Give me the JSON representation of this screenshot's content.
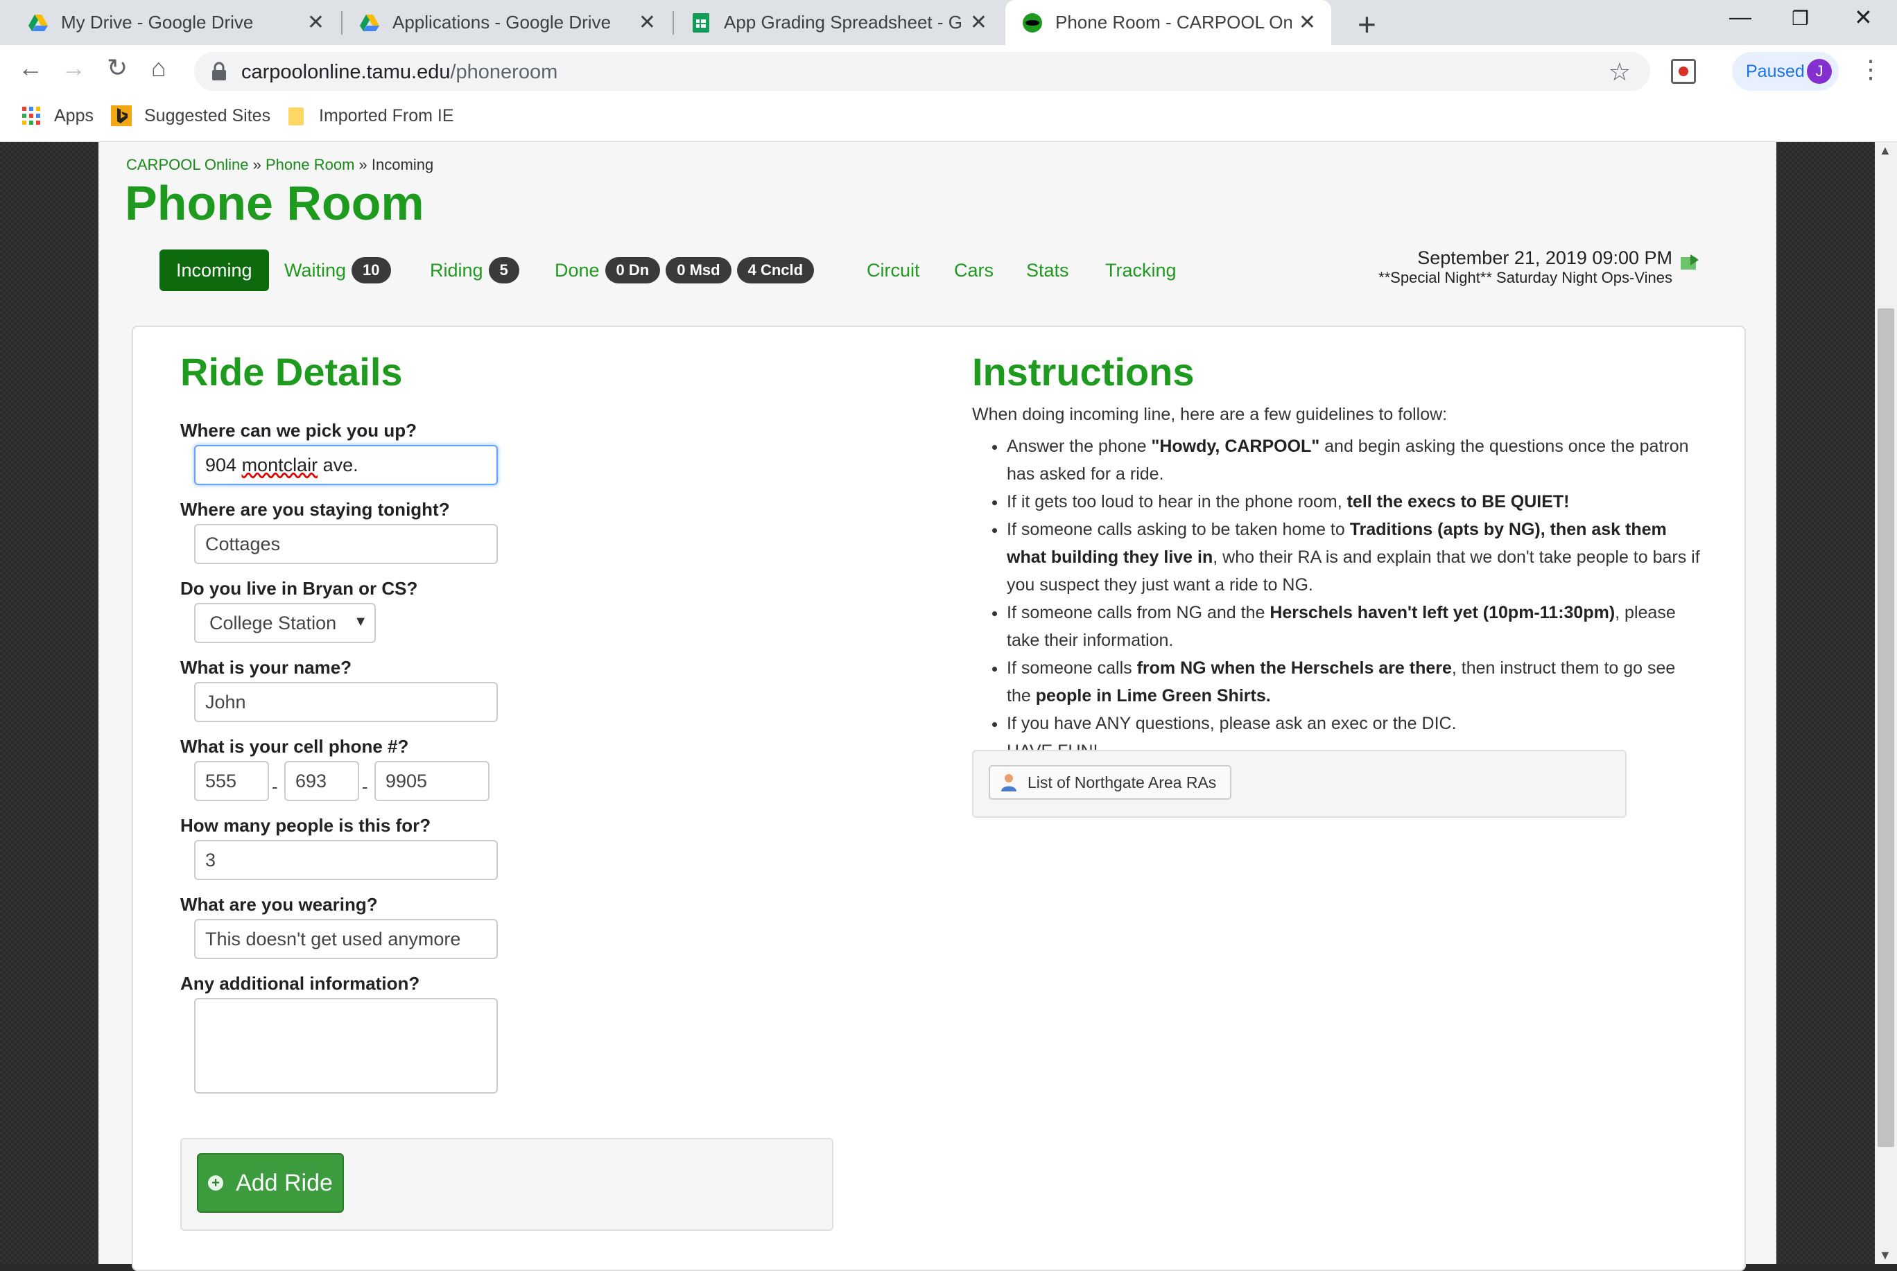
{
  "browser": {
    "tabs": [
      {
        "title": "My Drive - Google Drive",
        "icon": "google-drive-icon"
      },
      {
        "title": "Applications - Google Drive",
        "icon": "google-drive-icon"
      },
      {
        "title": "App Grading Spreadsheet - Goog",
        "icon": "google-sheets-icon"
      },
      {
        "title": "Phone Room - CARPOOL Online",
        "icon": "carpool-icon",
        "active": true
      }
    ],
    "url_host": "carpoolonline.tamu.edu",
    "url_path": "/phoneroom",
    "profile_status": "Paused",
    "profile_initial": "J",
    "bookmarks": [
      {
        "label": "Apps",
        "icon": "apps-grid-icon"
      },
      {
        "label": "Suggested Sites",
        "icon": "bing-icon"
      },
      {
        "label": "Imported From IE",
        "icon": "folder-icon"
      }
    ]
  },
  "breadcrumb": {
    "root": "CARPOOL Online",
    "sep1": "»",
    "section": "Phone Room",
    "sep2": "»",
    "current": "Incoming"
  },
  "page_title": "Phone Room",
  "nav": {
    "incoming": "Incoming",
    "waiting": {
      "label": "Waiting",
      "count": "10"
    },
    "riding": {
      "label": "Riding",
      "count": "5"
    },
    "done": {
      "label": "Done",
      "badges": [
        "0 Dn",
        "0 Msd",
        "4 Cncld"
      ]
    },
    "circuit": "Circuit",
    "cars": "Cars",
    "stats": "Stats",
    "tracking": "Tracking"
  },
  "datetime": "September 21, 2019 09:00 PM",
  "night_name": "**Special Night** Saturday Night Ops-Vines",
  "ride_details": {
    "heading": "Ride Details",
    "pickup": {
      "label": "Where can we pick you up?",
      "value_prefix": "904 ",
      "value_misspelled": "montclair",
      "value_suffix": " ave."
    },
    "staying": {
      "label": "Where are you staying tonight?",
      "value": "Cottages"
    },
    "city": {
      "label": "Do you live in Bryan or CS?",
      "value": "College Station"
    },
    "name": {
      "label": "What is your name?",
      "value": "John"
    },
    "phone": {
      "label": "What is your cell phone #?",
      "area": "555",
      "prefix": "693",
      "line": "9905",
      "sep": "-"
    },
    "people": {
      "label": "How many people is this for?",
      "value": "3"
    },
    "wearing": {
      "label": "What are you wearing?",
      "value": "This doesn't get used anymore"
    },
    "additional": {
      "label": "Any additional information?",
      "value": ""
    },
    "submit": "Add Ride"
  },
  "instructions": {
    "heading": "Instructions",
    "intro": "When doing incoming line, here are a few guidelines to follow:",
    "items": [
      {
        "p1": "Answer the phone ",
        "b1": "\"Howdy, CARPOOL\"",
        "p2": " and begin asking the questions once the patron has asked for a ride."
      },
      {
        "p1": "If it gets too loud to hear in the phone room, ",
        "b1": "tell the execs to BE QUIET!",
        "p2": ""
      },
      {
        "p1": "If someone calls asking to be taken home to ",
        "b1": "Traditions (apts by NG), then ask them what building they live in",
        "p2": ", who their RA is and explain that we don't take people to bars if you suspect they just want a ride to NG."
      },
      {
        "p1": "If someone calls from NG and the ",
        "b1": "Herschels haven't left yet (10pm-11:30pm)",
        "p2": ", please take their information."
      },
      {
        "p1": "If someone calls ",
        "b1": "from NG when the Herschels are there",
        "p2": ", then instruct them to go see the ",
        "b2": "people in Lime Green Shirts."
      },
      {
        "p1": "If you have ANY questions, please ask an exec or the DIC.",
        "b1": "",
        "p2": ""
      },
      {
        "p1": "HAVE FUN!",
        "b1": "",
        "p2": ""
      }
    ],
    "ra_button": "List of Northgate Area RAs"
  }
}
